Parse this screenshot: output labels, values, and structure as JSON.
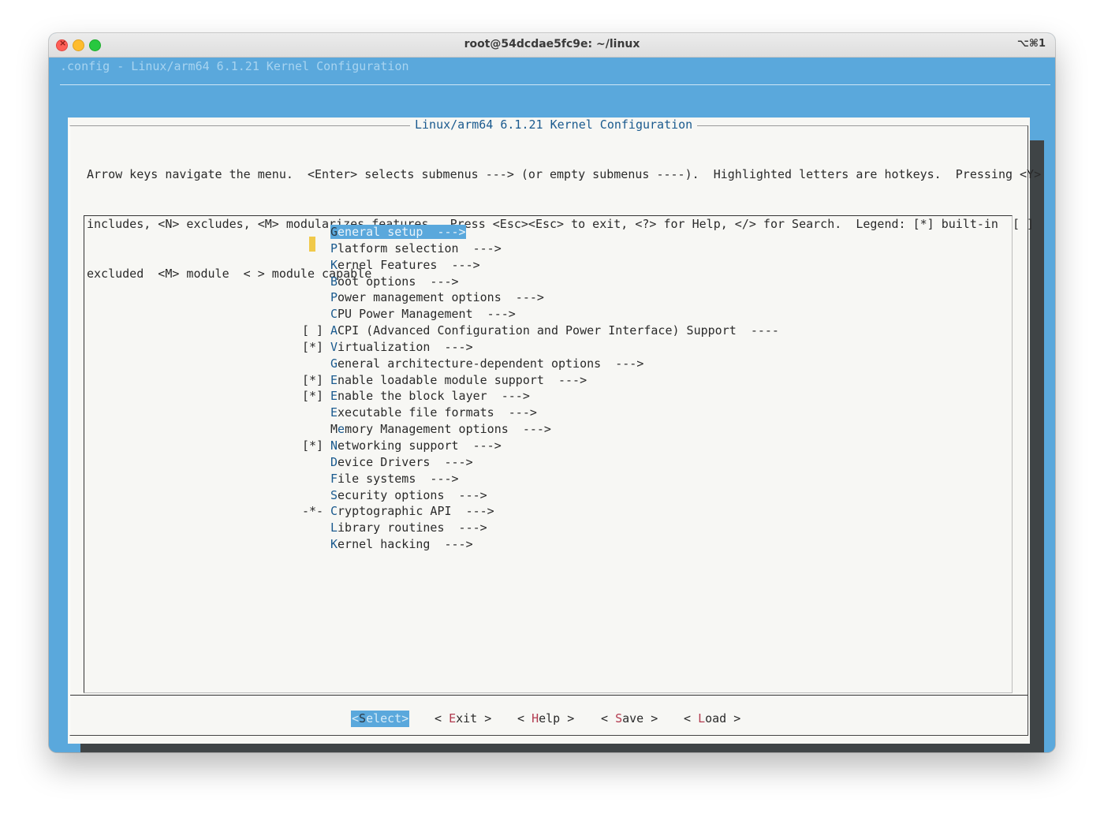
{
  "window": {
    "title": "root@54dcdae5fc9e: ~/linux",
    "shortcut": "⌥⌘1"
  },
  "terminal": {
    "backtitle": ".config - Linux/arm64 6.1.21 Kernel Configuration",
    "dialog_title": "Linux/arm64 6.1.21 Kernel Configuration",
    "help_lines": [
      "Arrow keys navigate the menu.  <Enter> selects submenus ---> (or empty submenus ----).  Highlighted letters are hotkeys.  Pressing <Y>",
      "includes, <N> excludes, <M> modularizes features.  Press <Esc><Esc> to exit, <?> for Help, </> for Search.  Legend: [*] built-in  [ ]",
      "excluded  <M> module  < > module capable"
    ],
    "menu": [
      {
        "mark": "",
        "hot": "G",
        "rest": "eneral setup  --->",
        "selected": true
      },
      {
        "mark": "",
        "hot": "P",
        "rest": "latform selection  --->"
      },
      {
        "mark": "",
        "hot": "K",
        "rest": "ernel Features  --->"
      },
      {
        "mark": "",
        "hot": "B",
        "rest": "oot options  --->"
      },
      {
        "mark": "",
        "hot": "P",
        "rest": "ower management options  --->"
      },
      {
        "mark": "",
        "hot": "C",
        "rest": "PU Power Management  --->"
      },
      {
        "mark": "[ ]",
        "hot": "A",
        "rest": "CPI (Advanced Configuration and Power Interface) Support  ----"
      },
      {
        "mark": "[*]",
        "hot": "V",
        "rest": "irtualization  --->"
      },
      {
        "mark": "",
        "hot": "G",
        "rest": "eneral architecture-dependent options  --->"
      },
      {
        "mark": "[*]",
        "hot": "E",
        "rest": "nable loadable module support  --->"
      },
      {
        "mark": "[*]",
        "hot": "E",
        "rest": "nable the block layer  --->"
      },
      {
        "mark": "",
        "hot": "E",
        "rest": "xecutable file formats  --->"
      },
      {
        "mark": "",
        "pre": "M",
        "hot": "e",
        "rest": "mory Management options  --->"
      },
      {
        "mark": "[*]",
        "hot": "N",
        "rest": "etworking support  --->"
      },
      {
        "mark": "",
        "hot": "D",
        "rest": "evice Drivers  --->"
      },
      {
        "mark": "",
        "hot": "F",
        "rest": "ile systems  --->"
      },
      {
        "mark": "",
        "hot": "S",
        "rest": "ecurity options  --->"
      },
      {
        "mark": "-*-",
        "hot": "C",
        "rest": "ryptographic API  --->"
      },
      {
        "mark": "",
        "hot": "L",
        "rest": "ibrary routines  --->"
      },
      {
        "mark": "",
        "hot": "K",
        "rest": "ernel hacking  --->"
      }
    ],
    "buttons": {
      "select": {
        "open": "<",
        "hot": "S",
        "rest": "elect",
        "close": ">"
      },
      "exit": {
        "open": "< ",
        "hot": "E",
        "rest": "xit",
        "close": " >"
      },
      "help": {
        "open": "< ",
        "hot": "H",
        "rest": "elp",
        "close": " >"
      },
      "save": {
        "open": "< ",
        "hot": "S",
        "rest": "ave",
        "close": " >"
      },
      "load": {
        "open": "< ",
        "hot": "L",
        "rest": "oad",
        "close": " >"
      }
    }
  },
  "colors": {
    "terminal_bg": "#5aa8dc",
    "dialog_bg": "#f7f7f4",
    "hotkey": "#1a5a8e",
    "button_hotkey": "#b23b4f",
    "cursor": "#f0c94a"
  }
}
